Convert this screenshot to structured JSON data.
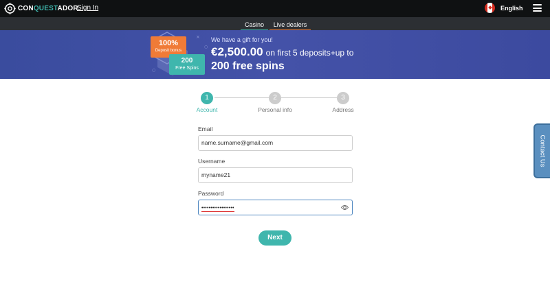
{
  "header": {
    "logo_prefix": "CON",
    "logo_main": "QUEST",
    "logo_suffix": "ADOR",
    "signin_label": "Sign In",
    "language": "English",
    "flag_icon": "canada-flag-icon",
    "menu_icon": "hamburger-menu-icon"
  },
  "subnav": {
    "tabs": [
      {
        "label": "Casino",
        "color": "#3fb6ad"
      },
      {
        "label": "Live dealers",
        "color": "#f07b37"
      }
    ]
  },
  "banner": {
    "badge_percent": "100%",
    "badge_percent_sub": "Deposit bonus",
    "badge_spins": "200",
    "badge_spins_sub": "Free Spins",
    "subtitle": "We have a gift for you!",
    "amount": "€2,500.00",
    "amount_rest": "on first 5 deposits+up to",
    "line2": "200 free spins"
  },
  "steps": [
    {
      "number": "1",
      "label": "Account",
      "active": true
    },
    {
      "number": "2",
      "label": "Personal info",
      "active": false
    },
    {
      "number": "3",
      "label": "Address",
      "active": false
    }
  ],
  "form": {
    "email_label": "Email",
    "email_value": "name.surname@gmail.com",
    "username_label": "Username",
    "username_value": "myname21",
    "password_label": "Password",
    "password_value": "••••••••••••••••••",
    "eye_icon": "eye-icon",
    "next_label": "Next"
  },
  "contact_label": "Contact Us",
  "colors": {
    "accent": "#3fb6ad",
    "orange": "#f07b37",
    "banner": "#4452a8",
    "topbar": "#0f1112"
  }
}
